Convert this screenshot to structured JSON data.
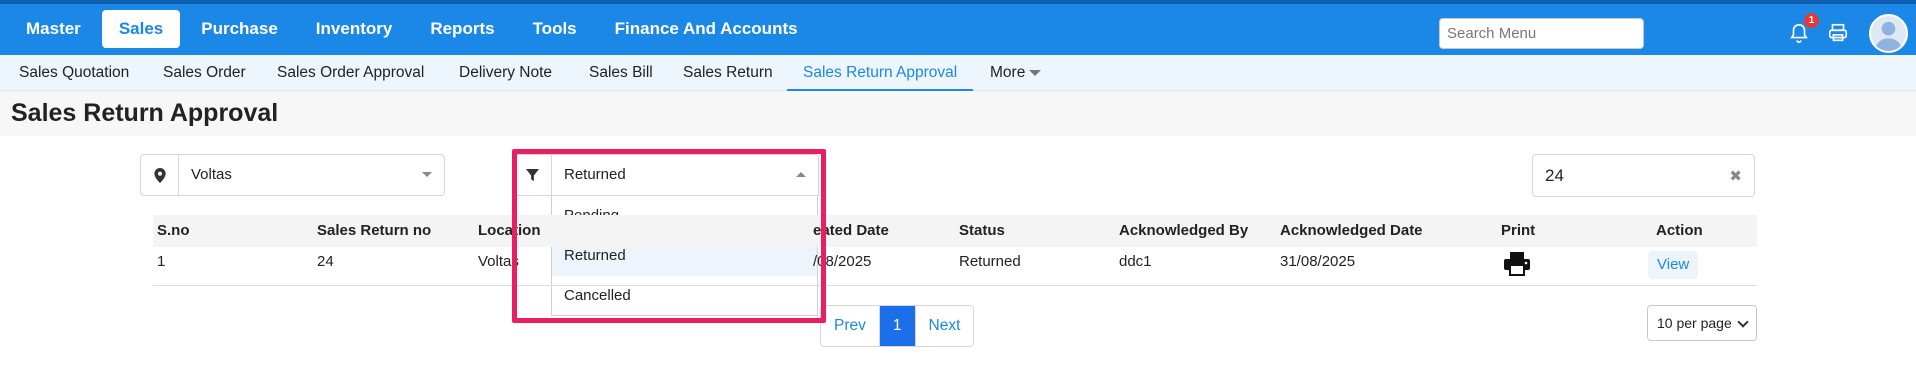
{
  "top_nav": [
    "Master",
    "Sales",
    "Purchase",
    "Inventory",
    "Reports",
    "Tools",
    "Finance And Accounts"
  ],
  "top_nav_active": "Sales",
  "search": {
    "placeholder": "Search Menu"
  },
  "notifications": {
    "count": "1",
    "icon": "bell-icon"
  },
  "sub_nav": [
    "Sales Quotation",
    "Sales Order",
    "Sales Order Approval",
    "Delivery Note",
    "Sales Bill",
    "Sales Return",
    "Sales Return Approval",
    "More"
  ],
  "sub_nav_active": "Sales Return Approval",
  "page_title": "Sales Return Approval",
  "location_select": {
    "value": "Voltas",
    "icon": "map-pin-icon"
  },
  "status_filter": {
    "value": "Returned",
    "icon": "filter-icon",
    "options": [
      "Pending",
      "Returned",
      "Cancelled"
    ],
    "selected": "Returned"
  },
  "search_value": "24",
  "table": {
    "headers": [
      "S.no",
      "Sales Return no",
      "Location",
      "Created Date",
      "Status",
      "Acknowledged By",
      "Acknowledged Date",
      "Print",
      "Action"
    ],
    "header_visible": [
      "S.no",
      "Sales Return no",
      "Location",
      "eated Date",
      "Status",
      "Acknowledged By",
      "Acknowledged Date",
      "Print",
      "Action"
    ],
    "rows": [
      {
        "sno": "1",
        "return_no": "24",
        "location": "Voltas",
        "created_date": "/08/2025",
        "status": "Returned",
        "ack_by": "ddc1",
        "ack_date": "31/08/2025",
        "print_icon": "printer-icon",
        "action": "View"
      }
    ]
  },
  "pagination": {
    "prev": "Prev",
    "current": "1",
    "next": "Next"
  },
  "per_page": "10 per page",
  "colors": {
    "primary": "#1b87e6",
    "highlight": "#e91e63"
  }
}
